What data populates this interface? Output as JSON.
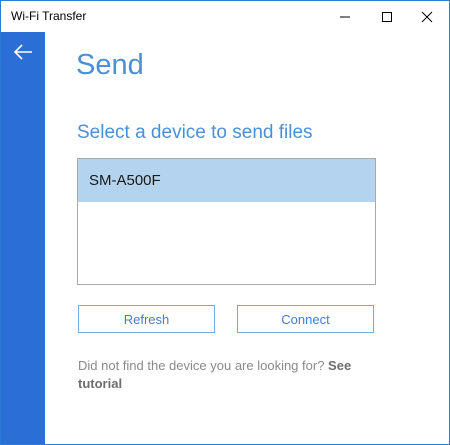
{
  "window": {
    "title": "Wi-Fi Transfer"
  },
  "titlebar": {
    "minimize_icon": "minimize-icon",
    "maximize_icon": "maximize-icon",
    "close_icon": "close-icon"
  },
  "sidebar": {
    "back_icon": "arrow-left-icon",
    "color": "#2b6fd6"
  },
  "page": {
    "title": "Send",
    "subtitle": "Select a device to send files"
  },
  "devices": [
    {
      "name": "SM-A500F",
      "selected": true
    }
  ],
  "buttons": {
    "refresh_label": "Refresh",
    "connect_label": "Connect"
  },
  "help": {
    "text": "Did not find the device you are looking for? ",
    "link": "See tutorial"
  },
  "colors": {
    "accent": "#4a90d9",
    "selection": "#b3d3ee",
    "button_border": "#7aa9df"
  }
}
